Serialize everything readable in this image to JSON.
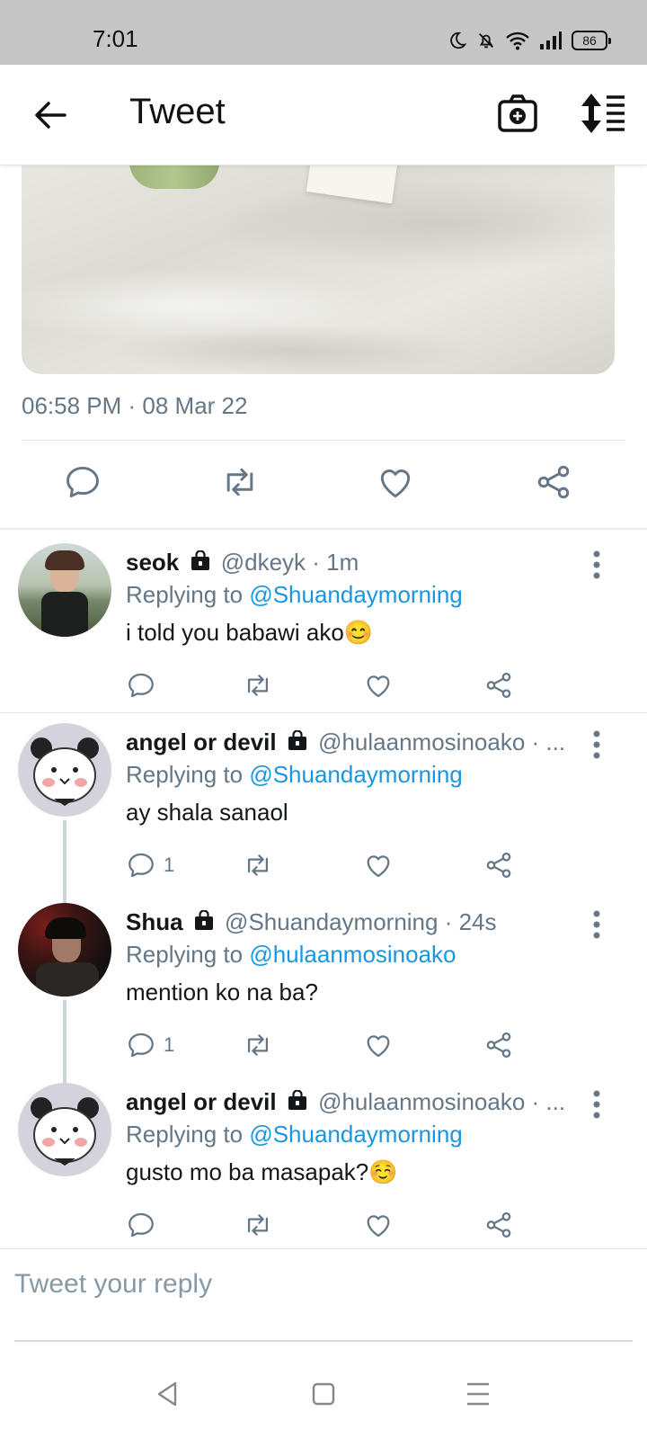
{
  "status_bar": {
    "time": "7:01",
    "battery": "86"
  },
  "app_bar": {
    "title": "Tweet"
  },
  "tweet": {
    "timestamp": "06:58 PM · 08 Mar 22"
  },
  "replies": [
    {
      "name": "seok",
      "handle": "@dkeyk · 1m",
      "replying_prefix": "Replying to ",
      "replying_to": "@Shuandaymorning",
      "text": "i told you babawi ako😊",
      "reply_count": ""
    },
    {
      "name": "angel or devil",
      "handle": "@hulaanmosinoako · ...",
      "replying_prefix": "Replying to ",
      "replying_to": "@Shuandaymorning",
      "text": "ay shala sanaol",
      "reply_count": "1"
    },
    {
      "name": "Shua",
      "handle": "@Shuandaymorning · 24s",
      "replying_prefix": "Replying to ",
      "replying_to": "@hulaanmosinoako",
      "text": "mention ko na ba?",
      "reply_count": "1"
    },
    {
      "name": "angel or devil",
      "handle": "@hulaanmosinoako · ...",
      "replying_prefix": "Replying to ",
      "replying_to": "@Shuandaymorning",
      "text": "gusto mo ba masapak?☺️",
      "reply_count": ""
    }
  ],
  "compose": {
    "placeholder": "Tweet your reply"
  },
  "colors": {
    "accent": "#1b95e0",
    "muted": "#657786",
    "text": "#14171a"
  }
}
